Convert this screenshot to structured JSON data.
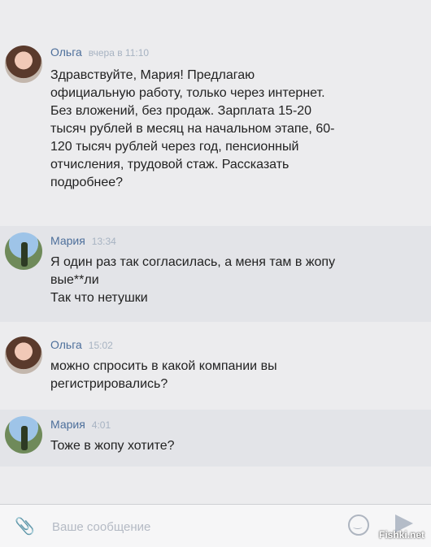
{
  "messages": [
    {
      "author": "Ольга",
      "time": "вчера в 11:10",
      "text": "Здравствуйте, Мария! Предлагаю\nофициальную работу, только через интернет.\nБез вложений, без продаж. Зарплата 15-20\nтысяч рублей в месяц на начальном этапе, 60-\n120 тысяч рублей через год, пенсионный\nотчисления, трудовой стаж. Рассказать\nподробнее?"
    },
    {
      "author": "Мария",
      "time": "13:34",
      "text": "Я один раз так согласилась, а меня там в жопу\nвые**ли\nТак что нетушки"
    },
    {
      "author": "Ольга",
      "time": "15:02",
      "text": "можно спросить в какой компании вы\nрегистрировались?"
    },
    {
      "author": "Мария",
      "time": "4:01",
      "text": "Тоже в жопу хотите?"
    }
  ],
  "composer": {
    "placeholder": "Ваше сообщение",
    "value": ""
  },
  "icons": {
    "attach": "paperclip-icon",
    "emoji": "smiley-icon",
    "send": "send-icon"
  },
  "watermark": "Fishki.net"
}
